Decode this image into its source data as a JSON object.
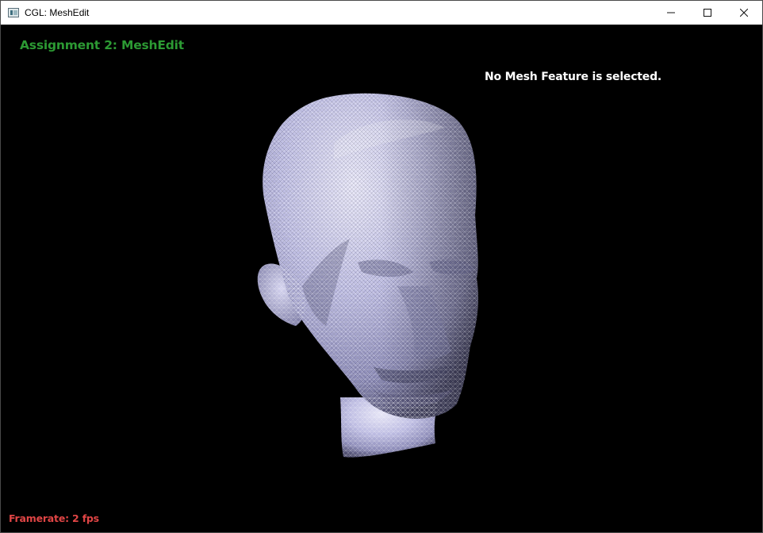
{
  "window": {
    "title": "CGL: MeshEdit",
    "controls": {
      "minimize": "minimize-icon",
      "maximize": "maximize-icon",
      "close": "close-icon"
    }
  },
  "hud": {
    "assignment_title": "Assignment 2: MeshEdit",
    "selection_status": "No Mesh Feature is selected.",
    "framerate": "Framerate: 2 fps"
  },
  "colors": {
    "viewport_background": "#000000",
    "title_color": "#2c9a33",
    "status_color": "#ffffff",
    "framerate_color": "#e04545",
    "mesh_color": "#b9b8e0"
  }
}
